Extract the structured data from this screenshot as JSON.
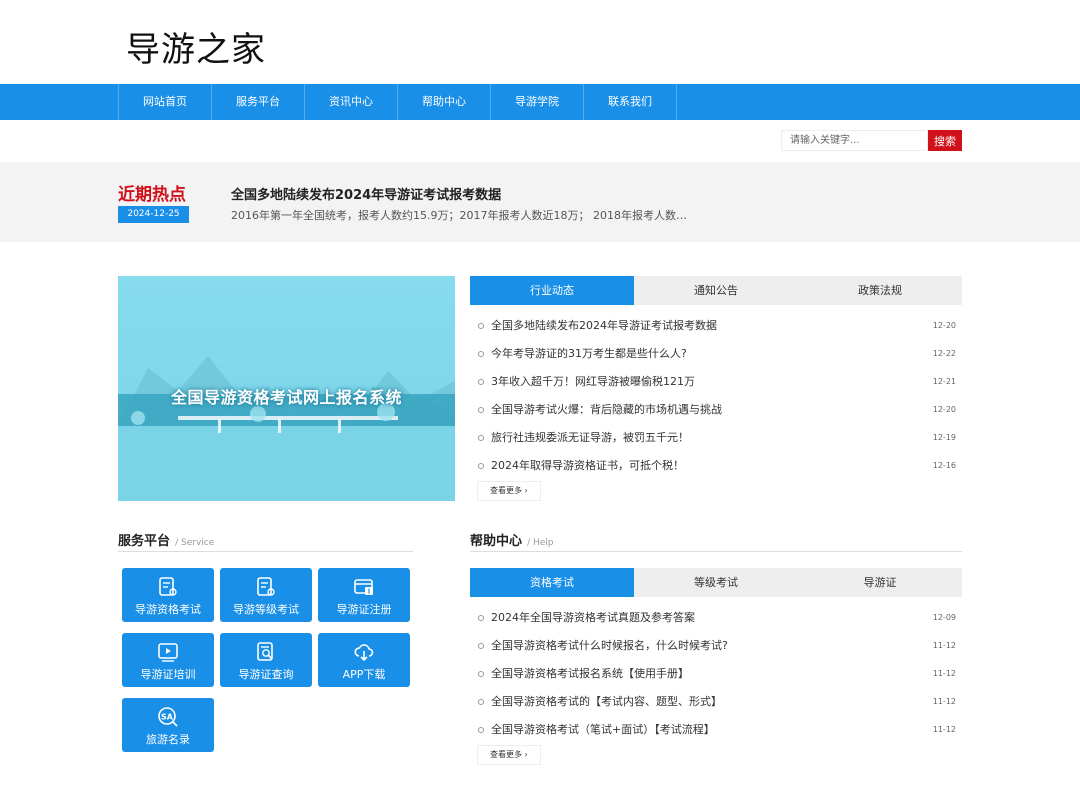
{
  "site": {
    "logo": "导游之家"
  },
  "nav": [
    "网站首页",
    "服务平台",
    "资讯中心",
    "帮助中心",
    "导游学院",
    "联系我们"
  ],
  "search": {
    "placeholder": "请输入关键字...",
    "button": "搜索"
  },
  "hot": {
    "title": "近期热点",
    "date": "2024-12-25",
    "headline": "全国多地陆续发布2024年导游证考试报考数据",
    "summary": "2016年第一年全国统考，报考人数约15.9万；2017年报考人数近18万； 2018年报考人数…"
  },
  "banner": {
    "text": "全国导游资格考试网上报名系统"
  },
  "news": {
    "tabs": [
      "行业动态",
      "通知公告",
      "政策法规"
    ],
    "active_tab": 0,
    "items": [
      {
        "title": "全国多地陆续发布2024年导游证考试报考数据",
        "date": "12-20"
      },
      {
        "title": "今年考导游证的31万考生都是些什么人?",
        "date": "12-22"
      },
      {
        "title": "3年收入超千万！网红导游被曝偷税121万",
        "date": "12-21"
      },
      {
        "title": "全国导游考试火爆：背后隐藏的市场机遇与挑战",
        "date": "12-20"
      },
      {
        "title": "旅行社违规委派无证导游，被罚五千元！",
        "date": "12-19"
      },
      {
        "title": "2024年取得导游资格证书，可抵个税！",
        "date": "12-16"
      }
    ],
    "more": "查看更多 ›"
  },
  "service": {
    "title": "服务平台",
    "subtitle": "/ Service",
    "buttons": [
      {
        "label": "导游资格考试",
        "icon": "document-icon"
      },
      {
        "label": "导游等级考试",
        "icon": "document-icon"
      },
      {
        "label": "导游证注册",
        "icon": "card-register-icon"
      },
      {
        "label": "导游证培训",
        "icon": "video-play-icon"
      },
      {
        "label": "导游证查询",
        "icon": "search-document-icon"
      },
      {
        "label": "APP下载",
        "icon": "cloud-download-icon"
      },
      {
        "label": "旅游名录",
        "icon": "sa-icon"
      }
    ]
  },
  "help": {
    "title": "帮助中心",
    "subtitle": "/ Help",
    "tabs": [
      "资格考试",
      "等级考试",
      "导游证"
    ],
    "active_tab": 0,
    "items": [
      {
        "title": "2024年全国导游资格考试真题及参考答案",
        "date": "12-09"
      },
      {
        "title": "全国导游资格考试什么时候报名，什么时候考试?",
        "date": "11-12"
      },
      {
        "title": "全国导游资格考试报名系统【使用手册】",
        "date": "11-12"
      },
      {
        "title": "全国导游资格考试的【考试内容、题型、形式】",
        "date": "11-12"
      },
      {
        "title": "全国导游资格考试（笔试+面试）【考试流程】",
        "date": "11-12"
      }
    ],
    "more": "查看更多 ›"
  },
  "colors": {
    "primary": "#1a8fe8",
    "accent": "#d0111b"
  }
}
